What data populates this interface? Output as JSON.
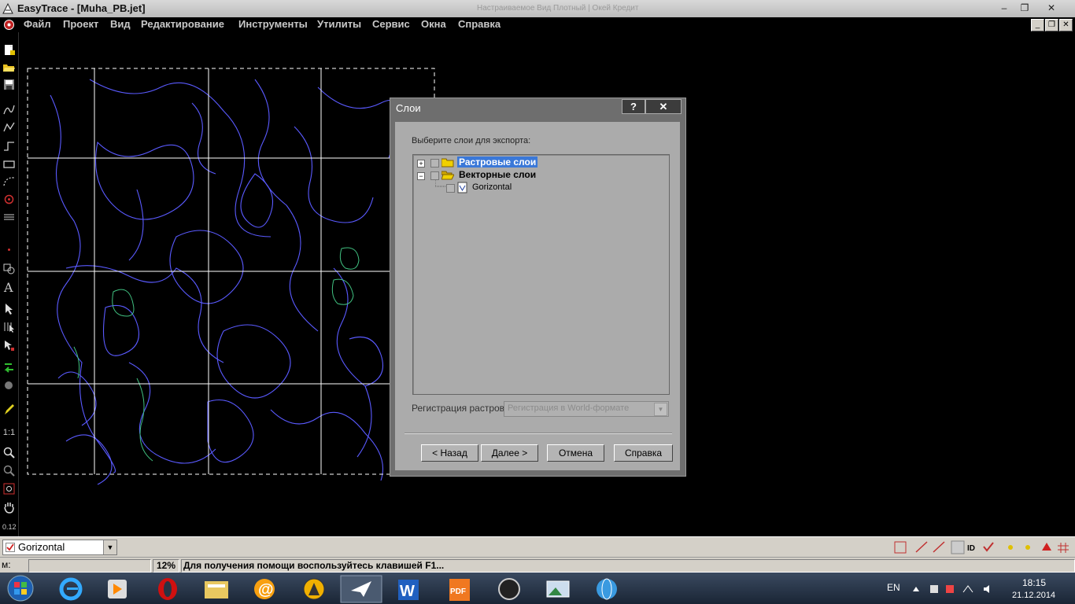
{
  "window": {
    "title": "EasyTrace - [Muha_PB.jet]",
    "faint_title": "Настраиваемое Вид Плотный | Окей Кредит"
  },
  "menu": [
    "Файл",
    "Проект",
    "Вид",
    "Редактирование",
    "Инструменты",
    "Утилиты",
    "Сервис",
    "Окна",
    "Справка"
  ],
  "window_buttons": {
    "minimize": "–",
    "restore": "❐",
    "close": "✕"
  },
  "mdi_buttons": {
    "minimize": "_",
    "restore": "❐",
    "close": "✕"
  },
  "dialog": {
    "title": "Слои",
    "help_btn": "?",
    "close_btn": "✕",
    "prompt": "Выберите слои для экспорта:",
    "tree": [
      {
        "label": "Растровые слои",
        "expander": "+",
        "selected": true
      },
      {
        "label": "Векторные слои",
        "expander": "−",
        "selected": false
      },
      {
        "label": "Gorizontal",
        "expander": "",
        "selected": false
      }
    ],
    "registration_label": "Регистрация растров:",
    "registration_value": "Регистрация в World-формате",
    "buttons": {
      "back": "< Назад",
      "next": "Далее >",
      "cancel": "Отмена",
      "help": "Справка"
    }
  },
  "layerbar": {
    "current_layer": "Gorizontal"
  },
  "statusbar": {
    "mode": "м:",
    "zoom": "12%",
    "hint": "Для получения помощи воспользуйтесь клавишей F1..."
  },
  "left_tools": [
    "1:1",
    "0.12"
  ],
  "tray": {
    "lang": "EN",
    "time": "18:15",
    "date": "21.12.2014"
  },
  "colors": {
    "contour_blue": "#5a5aff",
    "contour_green": "#40c080",
    "grid": "#ffffff",
    "selection": "#3a78d8"
  }
}
